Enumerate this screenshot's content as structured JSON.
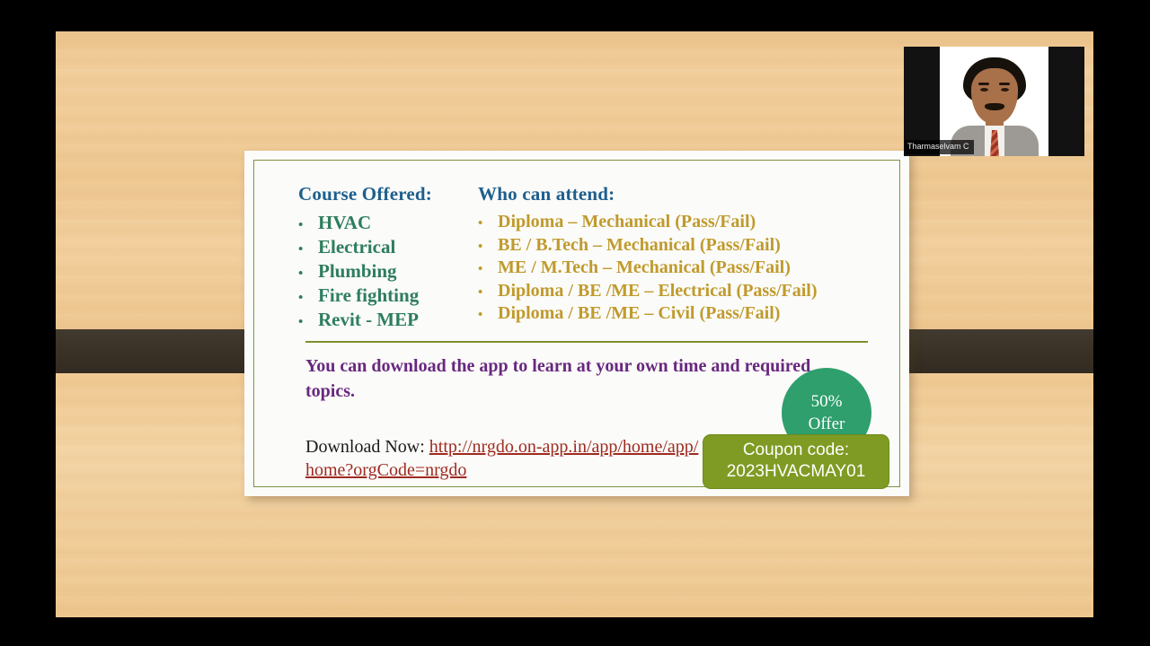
{
  "window": {
    "type": "video-player-letterbox",
    "background_color": "#000000"
  },
  "slide": {
    "background_color": "#eec791",
    "card_background": "#fbfbf9",
    "card_border_color": "#7f9340",
    "ribbon_color": "#393125",
    "divider_color": "#7d8f2c",
    "columns": {
      "left": {
        "heading": "Course Offered:",
        "heading_color": "#1d5f8d",
        "item_color": "#2e7d5e",
        "bullet_glyph": "•",
        "items": [
          "HVAC",
          "Electrical",
          "Plumbing",
          "Fire fighting",
          "Revit - MEP"
        ]
      },
      "right": {
        "heading": "Who can attend:",
        "heading_color": "#1d5f8d",
        "item_color": "#c09a2c",
        "bullet_glyph": "•",
        "items": [
          "Diploma – Mechanical (Pass/Fail)",
          "BE / B.Tech – Mechanical (Pass/Fail)",
          "ME / M.Tech – Mechanical (Pass/Fail)",
          "Diploma / BE /ME – Electrical (Pass/Fail)",
          "Diploma / BE /ME – Civil (Pass/Fail)"
        ]
      }
    },
    "promo_text": "You can download the app to learn at your own time and required topics.",
    "promo_text_color": "#68287f",
    "download": {
      "label": "Download Now: ",
      "url_text": "http://nrgdo.on-app.in/app/home/app/home?orgCode=nrgdo",
      "url_color": "#9e2a20"
    },
    "offer_badge": {
      "line1": "50%",
      "line2": "Offer",
      "color": "#2e9f6d"
    },
    "coupon": {
      "label": "Coupon code:",
      "code": "2023HVACMAY01",
      "color": "#7f9b23"
    }
  },
  "webcam": {
    "participant_name": "Tharmaselvam C",
    "background_color": "#121212"
  }
}
